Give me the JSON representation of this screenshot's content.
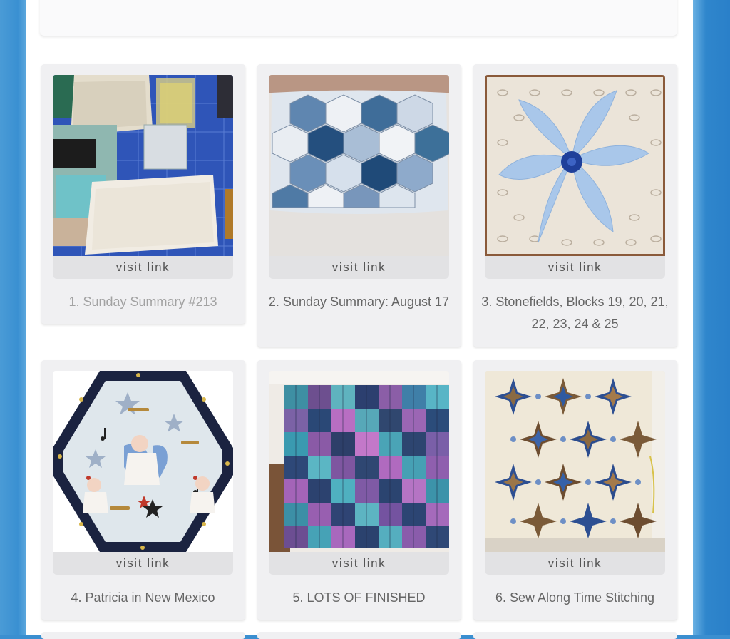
{
  "entries": [
    {
      "visit_label": "visit link",
      "title": "1. Sunday Summary #213"
    },
    {
      "visit_label": "visit link",
      "title": "2. Sunday Summary: August 17"
    },
    {
      "visit_label": "visit link",
      "title": "3. Stonefields, Blocks 19, 20, 21, 22, 23, 24 & 25"
    },
    {
      "visit_label": "visit link",
      "title": "4. Patricia in New Mexico"
    },
    {
      "visit_label": "visit link",
      "title": "5. LOTS OF FINISHED"
    },
    {
      "visit_label": "visit link",
      "title": "6. Sew Along Time Stitching"
    }
  ],
  "colors": {
    "side_blue": "#3b8fd0",
    "card_bg": "#f0f0f2",
    "visit_bg": "#e2e2e4",
    "title_text": "#666666",
    "visited_title_text": "#a2a2a2"
  }
}
